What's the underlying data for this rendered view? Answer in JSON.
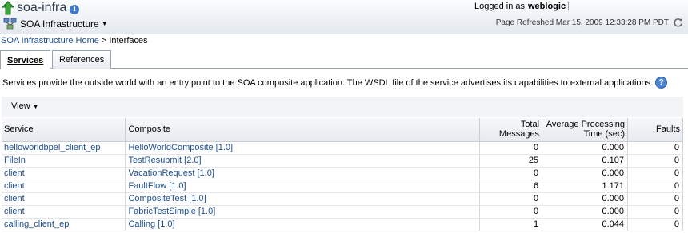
{
  "header": {
    "title": "soa-infra",
    "target_menu": "SOA Infrastructure",
    "login_prefix": "Logged in as",
    "user": "weblogic",
    "refresh_text": "Page Refreshed Mar 15, 2009 12:33:28 PM PDT"
  },
  "breadcrumb": {
    "home": "SOA Infrastructure Home",
    "separator": ">",
    "current": "Interfaces"
  },
  "tabs": [
    {
      "label": "Services",
      "active": true
    },
    {
      "label": "References",
      "active": false
    }
  ],
  "description": "Services provide the outside world with an entry point to the SOA composite application. The WSDL file of the service advertises its capabilities to external applications.",
  "toolbar": {
    "view_label": "View"
  },
  "table": {
    "headers": {
      "service": "Service",
      "composite": "Composite",
      "total_line1": "Total",
      "total_line2": "Messages",
      "avg_line1": "Average Processing",
      "avg_line2": "Time (sec)",
      "faults": "Faults"
    },
    "rows": [
      {
        "service": "helloworldbpel_client_ep",
        "composite": "HelloWorldComposite [1.0]",
        "total": "0",
        "avg": "0.000",
        "faults": "0"
      },
      {
        "service": "FileIn",
        "composite": "TestResubmit [2.0]",
        "total": "25",
        "avg": "0.107",
        "faults": "0"
      },
      {
        "service": "client",
        "composite": "VacationRequest [1.0]",
        "total": "0",
        "avg": "0.000",
        "faults": "0"
      },
      {
        "service": "client",
        "composite": "FaultFlow [1.0]",
        "total": "6",
        "avg": "1.171",
        "faults": "0"
      },
      {
        "service": "client",
        "composite": "CompositeTest [1.0]",
        "total": "0",
        "avg": "0.000",
        "faults": "0"
      },
      {
        "service": "client",
        "composite": "FabricTestSimple [1.0]",
        "total": "0",
        "avg": "0.000",
        "faults": "0"
      },
      {
        "service": "calling_client_ep",
        "composite": "Calling [1.0]",
        "total": "1",
        "avg": "0.044",
        "faults": "0"
      }
    ]
  },
  "colors": {
    "link": "#1e4f8f",
    "title": "#2b3a4e",
    "info_blue": "#3d78c9",
    "header_bg": "#e4e9ef"
  },
  "icons": {
    "up": "green-up-arrow-icon",
    "info": "info-icon",
    "target": "soa-infrastructure-icon",
    "refresh": "refresh-icon",
    "help": "help-icon"
  }
}
